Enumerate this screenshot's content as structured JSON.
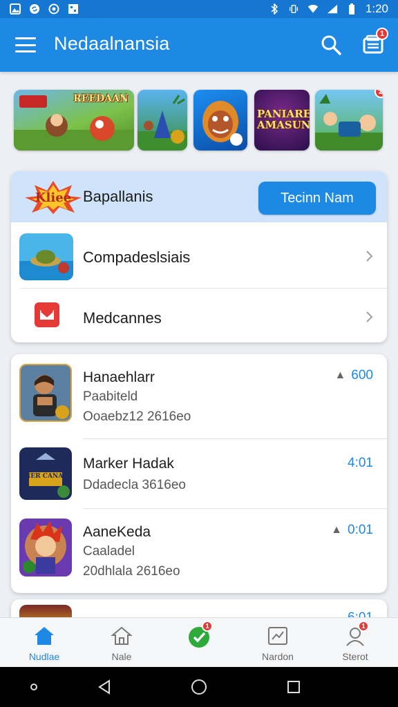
{
  "status_bar": {
    "time": "1:20",
    "left_icons": [
      "photo-icon",
      "sync-icon",
      "target-icon",
      "grid-icon"
    ],
    "right_icons": [
      "bluetooth-icon",
      "vibrate-icon",
      "wifi-icon",
      "signal-icon",
      "battery-icon"
    ]
  },
  "app_bar": {
    "title": "Nedaalnansia",
    "store_badge": "1",
    "colors": {
      "primary": "#1e88e5",
      "status": "#1677d2"
    }
  },
  "banners": [
    {
      "text": "REEDAAN",
      "icon": "banner-game-1"
    },
    {
      "text": "",
      "icon": "banner-game-2"
    },
    {
      "text": "",
      "icon": "banner-game-3"
    },
    {
      "text": "PANIARE AMASUN",
      "icon": "banner-game-4"
    },
    {
      "text": "",
      "icon": "banner-game-5",
      "badge": "2"
    }
  ],
  "featured_card": {
    "logo_text": "Kliee",
    "title": "Bapallanis",
    "button_label": "Tecinn Nam",
    "rows": [
      {
        "label": "Compadeslsiais",
        "icon": "island-thumbnail"
      },
      {
        "label": "Medcannes",
        "icon": "mail-icon"
      }
    ]
  },
  "games": [
    {
      "name": "Hanaehlarr",
      "subtitle": "Paabiteld",
      "meta": "Ooaebz12 2616eo",
      "score": "600",
      "trend": "up",
      "icon": "warrior-woman-icon"
    },
    {
      "name": "Marker Hadak",
      "subtitle": "Ddadecla 3616eo",
      "meta": "",
      "score": "4:01",
      "trend": "",
      "icon_text": "HANER CANAION",
      "icon": "castle-game-icon"
    },
    {
      "name": "AaneKeda",
      "subtitle": "Caaladel",
      "meta": "20dhlala 2616eo",
      "score": "0:01",
      "trend": "up",
      "icon": "hero-boy-icon"
    }
  ],
  "peek_card": {
    "score": "6:01"
  },
  "bottom_nav": [
    {
      "label": "Nudlae",
      "icon": "home-icon",
      "active": true
    },
    {
      "label": "Nale",
      "icon": "house-outline-icon"
    },
    {
      "label": "",
      "icon": "green-check-icon",
      "badge": "1"
    },
    {
      "label": "Nardon",
      "icon": "chart-frame-icon"
    },
    {
      "label": "Sterot",
      "icon": "profile-icon",
      "badge": "1"
    }
  ]
}
